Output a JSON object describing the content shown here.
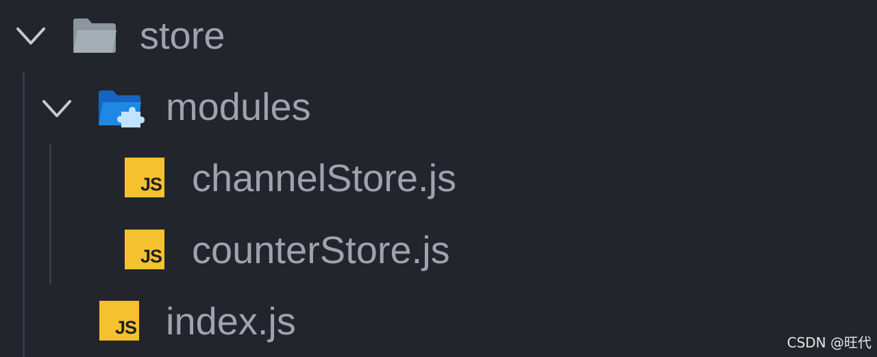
{
  "explorer": {
    "items": [
      {
        "label": "store",
        "expanded": true,
        "icon": "folder-icon"
      },
      {
        "label": "modules",
        "expanded": true,
        "icon": "folder-modules-icon"
      },
      {
        "label": "channelStore.js",
        "icon": "javascript-file-icon"
      },
      {
        "label": "counterStore.js",
        "icon": "javascript-file-icon"
      },
      {
        "label": "index.js",
        "icon": "javascript-file-icon"
      }
    ]
  },
  "js_badge_text": "JS",
  "watermark": "CSDN @旺代",
  "colors": {
    "background": "#23252c",
    "text": "#a0a3ab",
    "folder": "#8d969d",
    "modules_folder": "#1e88e5",
    "js_badge": "#f5c12e"
  }
}
